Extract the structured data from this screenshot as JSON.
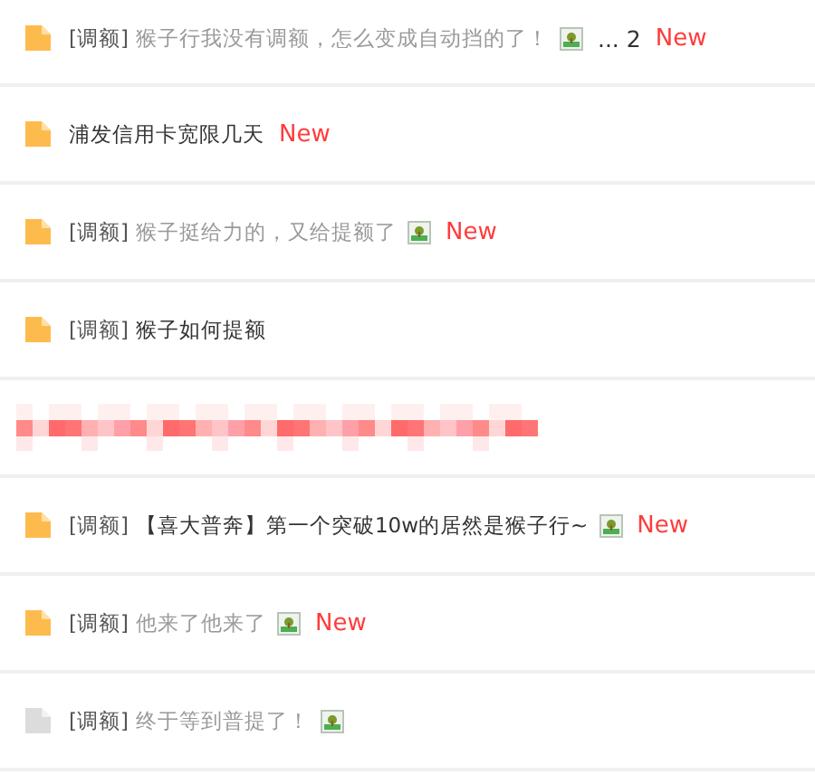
{
  "threads": [
    {
      "kind": "thread",
      "tag": "[调额]",
      "title": "猴子行我没有调额，怎么变成自动挡的了！",
      "visited": true,
      "icon_active": true,
      "has_image": true,
      "pages": "... 2",
      "badge": "New"
    },
    {
      "kind": "thread",
      "title": "浦发信用卡宽限几天",
      "visited": false,
      "icon_active": true,
      "badge": "New"
    },
    {
      "kind": "thread",
      "tag": "[调额]",
      "title": "猴子挺给力的，又给提额了",
      "visited": true,
      "icon_active": true,
      "has_image": true,
      "badge": "New"
    },
    {
      "kind": "thread",
      "tag": "[调额]",
      "title": "猴子如何提额",
      "visited": false,
      "icon_active": true
    },
    {
      "kind": "redacted"
    },
    {
      "kind": "thread",
      "tag": "[调额]",
      "title": "【喜大普奔】第一个突破10w的居然是猴子行~",
      "visited": false,
      "icon_active": true,
      "has_image": true,
      "badge": "New"
    },
    {
      "kind": "thread",
      "tag": "[调额]",
      "title": "他来了他来了",
      "visited": true,
      "icon_active": true,
      "has_image": true,
      "badge": "New"
    },
    {
      "kind": "thread",
      "tag": "[调额]",
      "title": "终于等到普提了！",
      "visited": true,
      "icon_active": false,
      "has_image": true
    }
  ]
}
